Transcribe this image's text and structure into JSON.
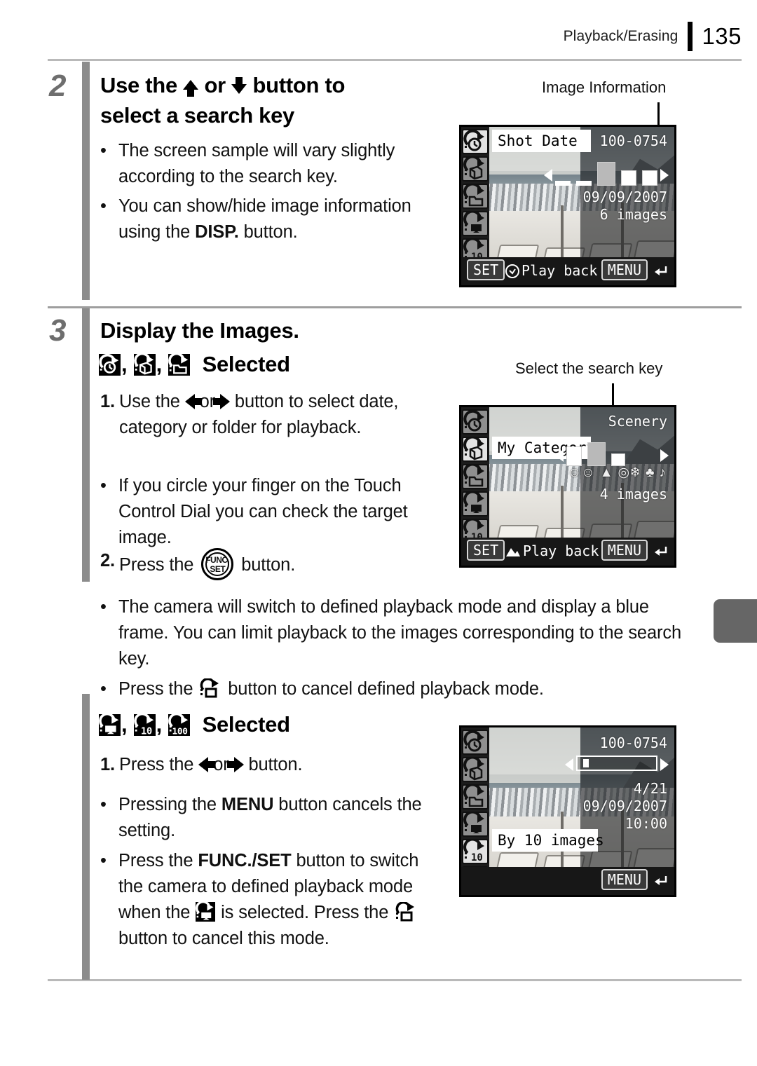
{
  "header": {
    "section": "Playback/Erasing",
    "page_number": "135"
  },
  "steps": [
    {
      "number": "2",
      "heading_line1_pre": "Use the ",
      "heading_line1_mid": " or ",
      "heading_line1_post": " button to",
      "heading_line2": "select a search key",
      "bullets": [
        "The screen sample will vary slightly according to the search key.",
        "You can show/hide image information using the DISP. button."
      ]
    },
    {
      "number": "3",
      "heading": "Display the Images.",
      "subheading_selected": "Selected",
      "item1_pre": "Use the ",
      "item1_mid": " or ",
      "item1_post": " button to select date, category or folder for playback.",
      "item1_number": "1.",
      "bullet_touch": "If you circle your finger on the Touch Control Dial you can check the target image.",
      "item2_number": "2.",
      "item2_pre": "Press the ",
      "item2_post": " button.",
      "bullet_defined": "The camera will switch to defined playback mode and display a blue frame. You can limit playback to the images corresponding to the search key.",
      "bullet_cancel_pre": "Press the ",
      "bullet_cancel_post": " button to cancel defined playback mode."
    }
  ],
  "section2": {
    "heading_selected": "Selected",
    "item1_number": "1.",
    "item1_pre": "Press the ",
    "item1_mid": " or ",
    "item1_post": " button.",
    "bullet_menu_pre": "Pressing the ",
    "bullet_menu_bold": "MENU",
    "bullet_menu_post": " button cancels the setting.",
    "bullet_funcset_pre": "Press the ",
    "bullet_funcset_bold": "FUNC./SET",
    "bullet_funcset_mid": " button to switch the camera to defined playback mode when the ",
    "bullet_funcset_mid2": " is selected. Press the ",
    "bullet_funcset_post": " button to cancel this mode."
  },
  "callouts": {
    "image_information": "Image Information",
    "select_search_key": "Select the search key"
  },
  "screens": [
    {
      "id": "screen-shot-date",
      "label": "Shot Date",
      "file_no": "100-0754",
      "date": "09/09/2007",
      "count": "6 images",
      "set_key": "SET",
      "set_action": "Play back",
      "menu_key": "MENU",
      "active_rail_index": 0
    },
    {
      "id": "screen-my-category",
      "label": "My Category",
      "category": "Scenery",
      "count": "4 images",
      "set_key": "SET",
      "set_action": "Play back",
      "menu_key": "MENU",
      "active_rail_index": 1,
      "category_symbols": [
        "people",
        "scenery",
        "events",
        "category1",
        "category2"
      ]
    },
    {
      "id": "screen-by-10-images",
      "label": "By 10 images",
      "file_no": "100-0754",
      "index": "4/21",
      "date": "09/09/2007",
      "time": "10:00",
      "menu_key": "MENU",
      "active_rail_index": 4
    }
  ],
  "rail_icons": [
    "date-jump-icon",
    "category-jump-icon",
    "folder-jump-icon",
    "movie-jump-icon",
    "jump-10-icon",
    "jump-100-icon"
  ],
  "heading_icons_step3": [
    "date-jump-icon",
    "category-jump-icon",
    "folder-jump-icon"
  ],
  "heading_icons_section2": [
    "movie-jump-icon",
    "jump-10-icon",
    "jump-100-icon"
  ],
  "colors": {
    "step_number": "#6e6e6e",
    "step_bar": "#8c8c8c",
    "rule": "#b9b9b9",
    "thumb_tab": "#666666"
  }
}
